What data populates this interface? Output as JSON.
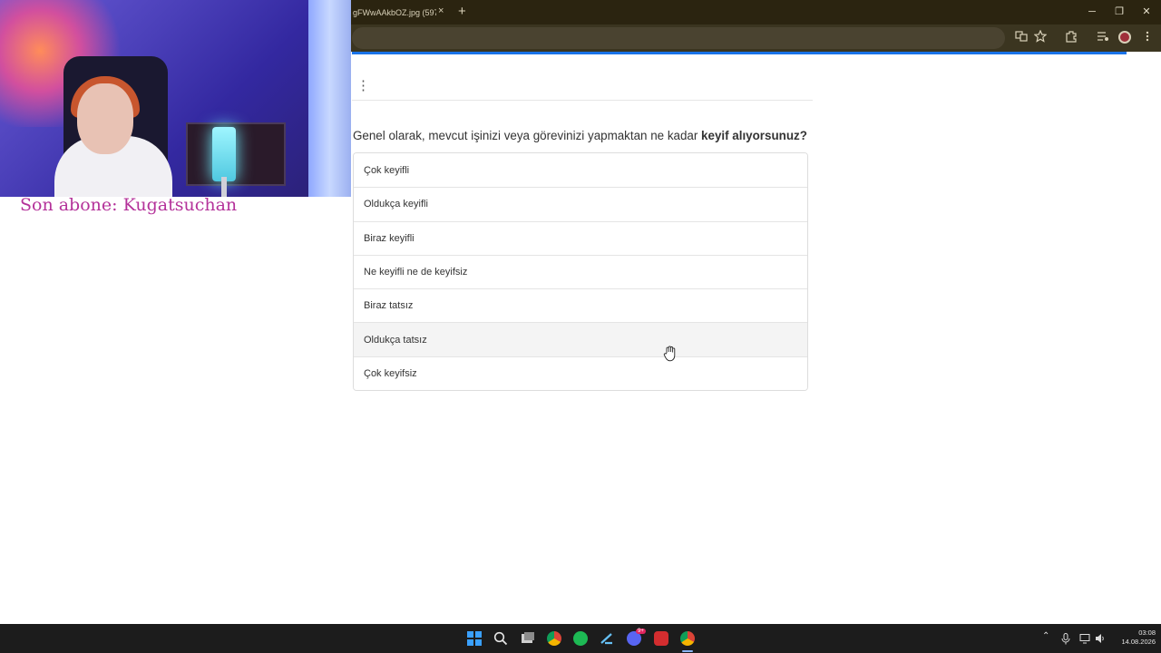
{
  "browser": {
    "tab_title": "gFWwAAkbOZ.jpg (597×",
    "tab_close": "×",
    "new_tab": "+",
    "window_controls": {
      "minimize": "─",
      "restore": "❐",
      "close": "✕"
    },
    "toolbar_icons": [
      "translate-icon",
      "star-icon",
      "extensions-icon",
      "media-icon",
      "profile-icon",
      "menu-icon"
    ],
    "accent_color": "#1a73e8"
  },
  "overlay": {
    "subscriber_text": "Son abone: Kugatsuchan",
    "subscriber_color": "#b4329a"
  },
  "survey": {
    "menu_icon": "⋮",
    "question_normal": "Genel olarak, mevcut işinizi veya görevinizi yapmaktan ne kadar ",
    "question_bold": "keyif alıyorsunuz?",
    "options": [
      "Çok keyifli",
      "Oldukça keyifli",
      "Biraz keyifli",
      "Ne keyifli ne de keyifsiz",
      "Biraz tatsız",
      "Oldukça tatsız",
      "Çok keyifsiz"
    ],
    "hovered_option_index": 5
  },
  "taskbar": {
    "apps": [
      "windows-start-icon",
      "search-icon",
      "task-view-icon",
      "chrome-icon",
      "spotify-icon",
      "steam-icon",
      "discord-icon",
      "app-red-icon",
      "chrome-active-icon"
    ],
    "discord_badge": "9+",
    "time": "03:08",
    "date": "14.08.2026"
  }
}
